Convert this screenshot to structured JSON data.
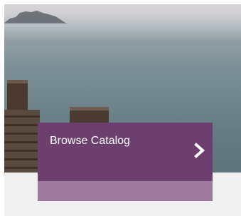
{
  "hero": {
    "image": "lake-dock-scene"
  },
  "card": {
    "title": "Browse Catalog",
    "icon": "chevron-right-icon",
    "colors": {
      "primary": "#6c3f6f",
      "secondary": "#a07ba0",
      "text": "#ffffff"
    }
  }
}
